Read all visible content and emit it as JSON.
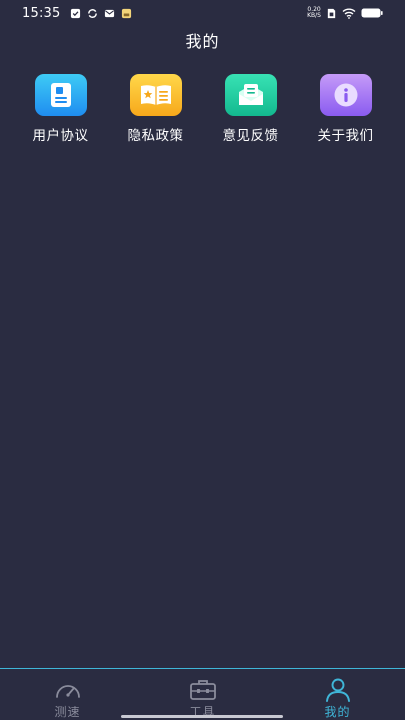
{
  "status_bar": {
    "time": "15:35",
    "net_speed_value": "0.20",
    "net_speed_unit": "KB/S"
  },
  "header": {
    "title": "我的"
  },
  "menu": {
    "items": [
      {
        "label": "用户协议",
        "icon": "user-agreement-icon",
        "color_top": "#3ecbf5",
        "color_bottom": "#1f8df0"
      },
      {
        "label": "隐私政策",
        "icon": "privacy-book-icon",
        "color_top": "#ffd84a",
        "color_bottom": "#f7a81b"
      },
      {
        "label": "意见反馈",
        "icon": "feedback-mail-icon",
        "color_top": "#38e2b4",
        "color_bottom": "#13b98f"
      },
      {
        "label": "关于我们",
        "icon": "info-icon",
        "color_top": "#c59bf8",
        "color_bottom": "#8a5bf0"
      }
    ]
  },
  "bottom_nav": {
    "items": [
      {
        "label": "测速",
        "icon": "speedometer-icon",
        "active": false
      },
      {
        "label": "工具",
        "icon": "toolbox-icon",
        "active": false
      },
      {
        "label": "我的",
        "icon": "person-icon",
        "active": true
      }
    ],
    "active_color": "#3fb6d8",
    "inactive_color": "#8a8c9c"
  }
}
